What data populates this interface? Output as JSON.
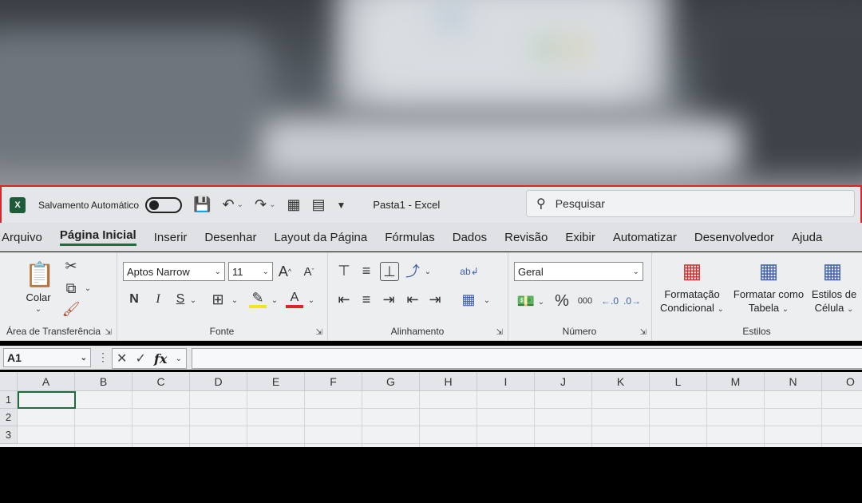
{
  "titlebar": {
    "app_icon": "X",
    "autosave_label": "Salvamento Automático",
    "doc_title": "Pasta1  -  Excel",
    "search_placeholder": "Pesquisar"
  },
  "menu": {
    "tabs": [
      "Arquivo",
      "Página Inicial",
      "Inserir",
      "Desenhar",
      "Layout da Página",
      "Fórmulas",
      "Dados",
      "Revisão",
      "Exibir",
      "Automatizar",
      "Desenvolvedor",
      "Ajuda"
    ],
    "active": "Página Inicial"
  },
  "ribbon": {
    "clipboard": {
      "paste_label": "Colar",
      "group_label": "Área de Transferência"
    },
    "font": {
      "font_name": "Aptos Narrow",
      "font_size": "11",
      "bold": "N",
      "italic": "I",
      "underline": "S",
      "grow": "A",
      "shrink": "A",
      "group_label": "Fonte"
    },
    "alignment": {
      "group_label": "Alinhamento"
    },
    "number": {
      "format": "Geral",
      "percent": "%",
      "thousands": "000",
      "group_label": "Número"
    },
    "styles": {
      "conditional_line1": "Formatação",
      "conditional_line2": "Condicional",
      "table_line1": "Formatar como",
      "table_line2": "Tabela",
      "cell_line1": "Estilos de",
      "cell_line2": "Célula",
      "group_label": "Estilos"
    }
  },
  "formula_bar": {
    "name_box": "A1",
    "fx": "fx"
  },
  "grid": {
    "columns": [
      "A",
      "B",
      "C",
      "D",
      "E",
      "F",
      "G",
      "H",
      "I",
      "J",
      "K",
      "L",
      "M",
      "N",
      "O"
    ],
    "rows": [
      "1",
      "2",
      "3"
    ]
  },
  "colors": {
    "accent": "#1d6e3f",
    "highlight_border": "#d9262a",
    "save_icon": "#7b2a8a"
  }
}
